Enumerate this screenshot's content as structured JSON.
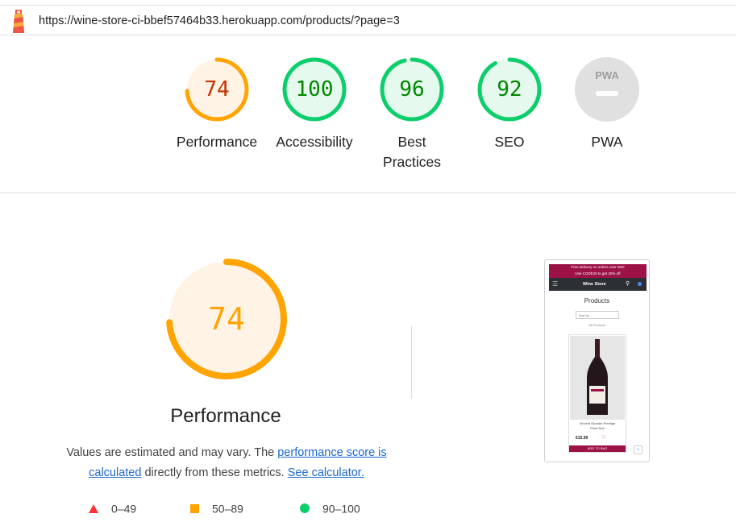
{
  "url_bar": {
    "url": "https://wine-store-ci-bbef57464b33.herokuapp.com/products/?page=3"
  },
  "gauges": [
    {
      "name": "Performance",
      "score": "74",
      "value": 74,
      "status": "average"
    },
    {
      "name": "Accessibility",
      "score": "100",
      "value": 100,
      "status": "pass"
    },
    {
      "name": "Best Practices",
      "score": "96",
      "value": 96,
      "status": "pass"
    },
    {
      "name": "SEO",
      "score": "92",
      "value": 92,
      "status": "pass"
    },
    {
      "name": "PWA",
      "badge": "PWA",
      "status": "na"
    }
  ],
  "performance": {
    "score": "74",
    "value": 74,
    "title": "Performance",
    "desc_prefix": "Values are estimated and may vary. The ",
    "link_score": "performance score is calculated",
    "desc_mid": " directly from these metrics. ",
    "link_calc": "See calculator."
  },
  "legend": {
    "fail": "0–49",
    "average": "50–89",
    "pass": "90–100"
  },
  "colors": {
    "fail": "#ff3333",
    "average": "#ffa400",
    "pass": "#0cce6b",
    "link": "#1967d2"
  },
  "screenshot": {
    "banner_line1": "Free delivery on orders over €50!",
    "banner_line2": "Use CODE20 to get 20% off",
    "brand": "Wine Store",
    "heading": "Products",
    "sort": "Sort by...",
    "count": "28 Products",
    "product_name": "Vincent Girardin Prestige",
    "product_sub": "Pinot Noir",
    "price": "€15.99",
    "add_button": "ADD TO BAG"
  }
}
